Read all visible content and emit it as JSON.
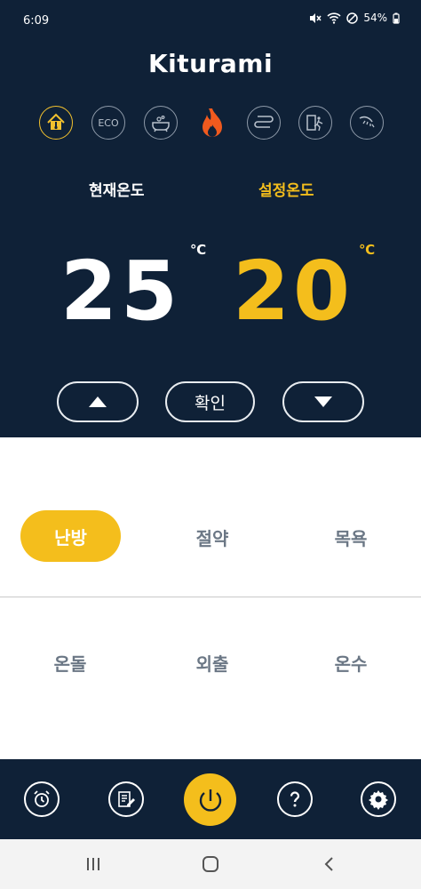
{
  "status_bar": {
    "time": "6:09",
    "battery": "54%",
    "icons": [
      "mute-icon",
      "wifi-icon",
      "do-not-disturb-icon",
      "battery-icon"
    ]
  },
  "app": {
    "logo_text": "Kiturami"
  },
  "mode_icons": [
    "home-thermometer-icon",
    "eco-icon",
    "bath-icon",
    "flame-icon",
    "floor-heating-icon",
    "exit-icon",
    "shower-icon"
  ],
  "mode_eco_label": "ECO",
  "temperature": {
    "current_label": "현재온도",
    "set_label": "설정온도",
    "current_value": "25",
    "set_value": "20",
    "unit": "℃"
  },
  "controls": {
    "up_icon": "triangle-up-icon",
    "confirm_label": "확인",
    "down_icon": "triangle-down-icon"
  },
  "options": {
    "row1": [
      "난방",
      "절약",
      "목욕"
    ],
    "row2": [
      "온돌",
      "외출",
      "온수"
    ],
    "selected": "난방"
  },
  "bottom_nav": [
    "alarm-icon",
    "memo-icon",
    "power-icon",
    "help-icon",
    "settings-icon"
  ],
  "colors": {
    "header_bg": "#0f2137",
    "accent": "#f4be1c",
    "flame": "#f05a1e",
    "option_text": "#6b7785"
  }
}
